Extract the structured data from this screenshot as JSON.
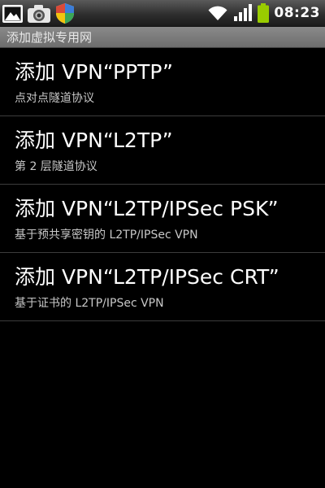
{
  "status_bar": {
    "left_icons": [
      "picture-icon",
      "camera-icon",
      "shield-icon"
    ],
    "right_icons": [
      "wifi-icon",
      "signal-icon",
      "battery-icon"
    ],
    "time": "08:23",
    "colors": {
      "wifi": "#ffffff",
      "battery": "#99cc00"
    }
  },
  "title_bar": {
    "title": "添加虚拟专用网"
  },
  "vpn_options": [
    {
      "title": "添加 VPN“PPTP”",
      "summary": "点对点隧道协议"
    },
    {
      "title": "添加 VPN“L2TP”",
      "summary": "第 2 层隧道协议"
    },
    {
      "title": "添加 VPN“L2TP/IPSec PSK”",
      "summary": "基于预共享密钥的 L2TP/IPSec VPN"
    },
    {
      "title": "添加 VPN“L2TP/IPSec CRT”",
      "summary": "基于证书的 L2TP/IPSec VPN"
    }
  ]
}
